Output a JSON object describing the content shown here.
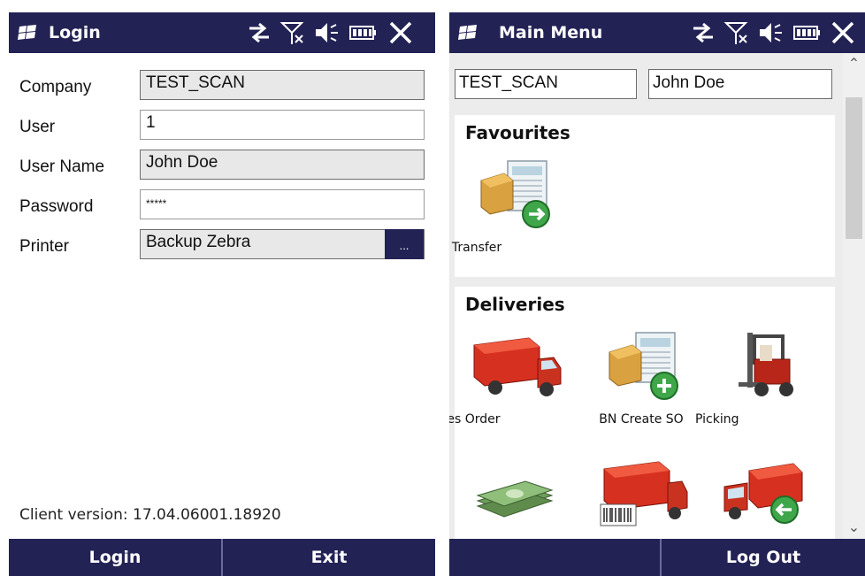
{
  "login_screen": {
    "title": "Login",
    "fields": [
      {
        "label": "Company",
        "value": "TEST_SCAN"
      },
      {
        "label": "User",
        "value": "1"
      },
      {
        "label": "User Name",
        "value": "John Doe"
      },
      {
        "label": "Password",
        "value": "*****"
      },
      {
        "label": "Printer",
        "value": "Backup Zebra",
        "browse_label": "..."
      }
    ],
    "client_version": "Client version: 17.04.06001.18920",
    "buttons": {
      "login": "Login",
      "exit": "Exit"
    }
  },
  "main_menu_screen": {
    "title": "Main Menu",
    "company_value": "TEST_SCAN",
    "user_value": "John Doe",
    "sections": [
      {
        "title": "Favourites",
        "tiles": [
          "BN SO Transfer"
        ]
      },
      {
        "title": "Deliveries",
        "tiles": [
          "Sales Order",
          "BN Create SO",
          "Picking"
        ]
      }
    ],
    "buttons": {
      "logout": "Log Out"
    }
  },
  "status_icons": [
    "connection-icon",
    "signal-icon",
    "volume-icon",
    "battery-icon",
    "close-icon"
  ],
  "colors": {
    "titlebar": "#232255",
    "field_readonly": "#e8e8e8",
    "menu_background": "#ececec"
  }
}
